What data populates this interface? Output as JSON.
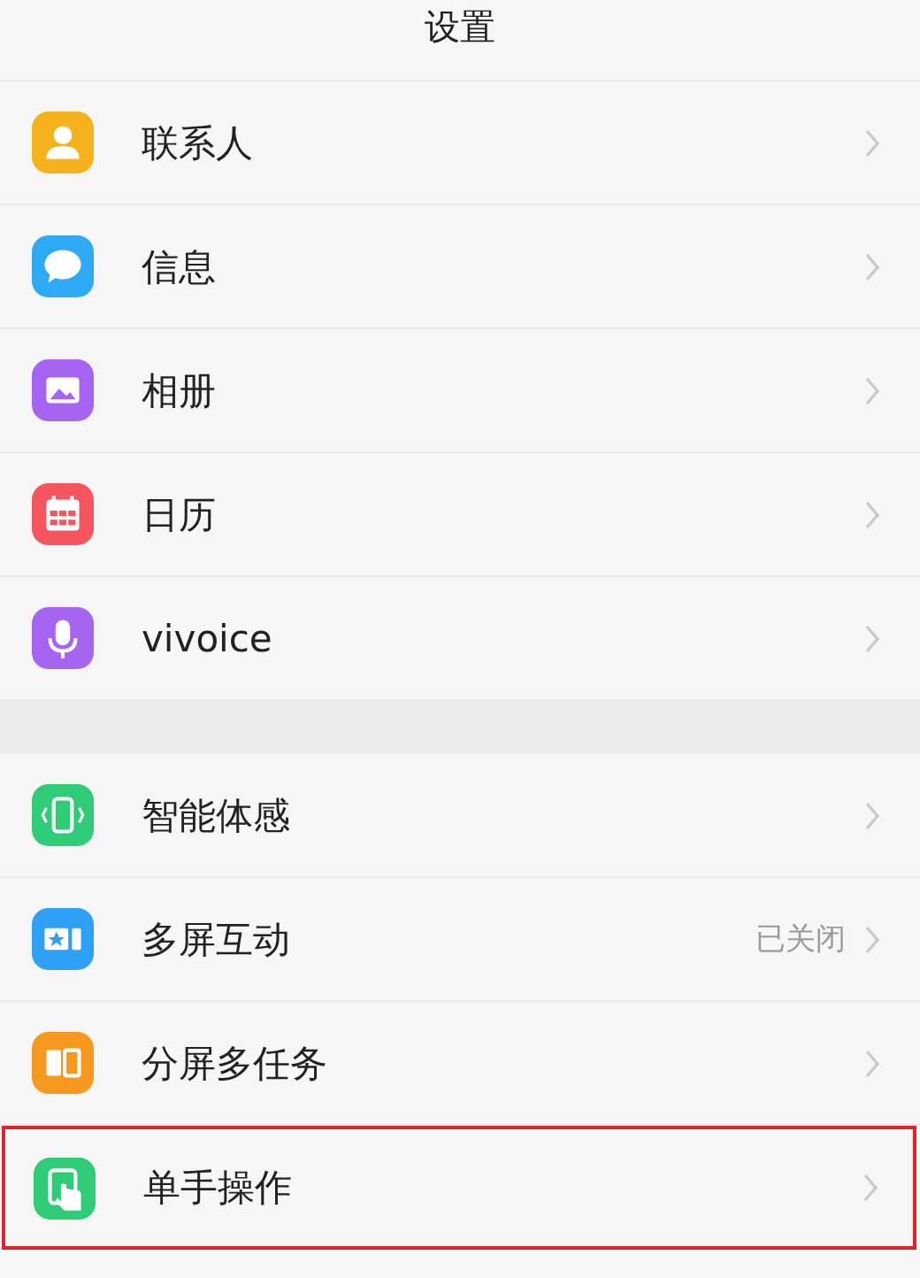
{
  "title": "设置",
  "groups": [
    {
      "items": [
        {
          "kind": "person",
          "color": "#f5b21c",
          "label": "联系人",
          "highlighted": false
        },
        {
          "kind": "bubble",
          "color": "#2eaaf5",
          "label": "信息",
          "highlighted": false
        },
        {
          "kind": "image",
          "color": "#a565f0",
          "label": "相册",
          "highlighted": false
        },
        {
          "kind": "calendar",
          "color": "#f5555f",
          "label": "日历",
          "highlighted": false
        },
        {
          "kind": "mic",
          "color": "#a565f0",
          "label": "vivoice",
          "highlighted": false
        }
      ]
    },
    {
      "items": [
        {
          "kind": "phone",
          "color": "#2fcb76",
          "label": "智能体感",
          "highlighted": false
        },
        {
          "kind": "screen",
          "color": "#2ea0f5",
          "label": "多屏互动",
          "value": "已关闭",
          "highlighted": false
        },
        {
          "kind": "split",
          "color": "#f7981f",
          "label": "分屏多任务",
          "highlighted": false
        },
        {
          "kind": "hand",
          "color": "#2fcb76",
          "label": "单手操作",
          "highlighted": true
        }
      ]
    }
  ]
}
